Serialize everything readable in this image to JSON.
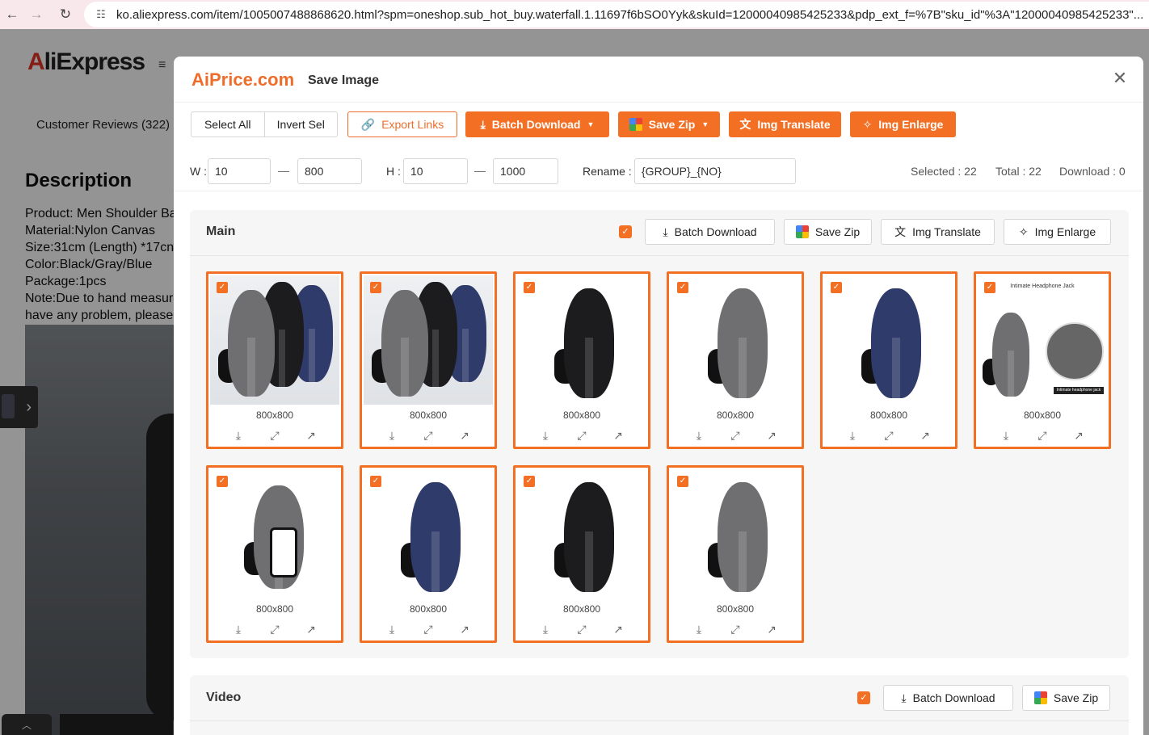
{
  "browser": {
    "url": "ko.aliexpress.com/item/1005007488868620.html?spm=oneshop.sub_hot_buy.waterfall.1.11697f6bSO0Yyk&skuId=12000040985425233&pdp_ext_f=%7B\"sku_id\"%3A\"12000040985425233\"..."
  },
  "page": {
    "logo_a": "A",
    "logo_rest": "liExpress",
    "reviews": "Customer Reviews (322)",
    "description_title": "Description",
    "description_lines": [
      "Product: Men Shoulder Ba",
      "Material:Nylon Canvas",
      "Size:31cm (Length) *17cn",
      "Color:Black/Gray/Blue",
      "Package:1pcs",
      "Note:Due to hand measur",
      "have any problem, please"
    ]
  },
  "modal": {
    "brand": "AiPrice.com",
    "title": "Save Image",
    "toolbar": {
      "select_all": "Select All",
      "invert_sel": "Invert Sel",
      "export_links": "Export Links",
      "batch_download": "Batch Download",
      "save_zip": "Save Zip",
      "img_translate": "Img Translate",
      "img_enlarge": "Img Enlarge"
    },
    "filters": {
      "w_label": "W :",
      "w_min": "10",
      "w_max": "800",
      "h_label": "H :",
      "h_min": "10",
      "h_max": "1000",
      "rename_label": "Rename :",
      "rename_value": "{GROUP}_{NO}"
    },
    "stats": {
      "selected": "Selected : 22",
      "total": "Total : 22",
      "download": "Download : 0"
    },
    "main": {
      "title": "Main",
      "batch_download": "Batch Download",
      "save_zip": "Save Zip",
      "img_translate": "Img Translate",
      "img_enlarge": "Img Enlarge",
      "images": [
        {
          "size": "800x800",
          "variant": "trio"
        },
        {
          "size": "800x800",
          "variant": "trio"
        },
        {
          "size": "800x800",
          "variant": "black"
        },
        {
          "size": "800x800",
          "variant": "gray"
        },
        {
          "size": "800x800",
          "variant": "blue"
        },
        {
          "size": "800x800",
          "variant": "jack",
          "caption": "Intimate Headphone Jack",
          "sub_caption": "Intimate headphone jack"
        },
        {
          "size": "800x800",
          "variant": "phone"
        },
        {
          "size": "800x800",
          "variant": "blue"
        },
        {
          "size": "800x800",
          "variant": "black"
        },
        {
          "size": "800x800",
          "variant": "gray"
        }
      ]
    },
    "video": {
      "title": "Video",
      "batch_download": "Batch Download",
      "save_zip": "Save Zip"
    }
  },
  "icons": {
    "check": "✓",
    "download": "⤓",
    "expand": "⤢",
    "open": "↗",
    "close": "✕"
  },
  "colors": {
    "accent": "#f36f24",
    "bag_black": "#1c1c1e",
    "bag_gray": "#6f6f72",
    "bag_blue": "#2f3b6b"
  }
}
